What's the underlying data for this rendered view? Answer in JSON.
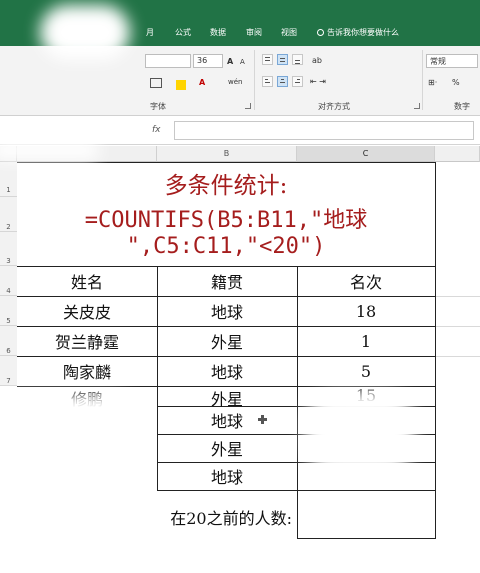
{
  "ribbon_tabs": [
    "月",
    "公式",
    "数据",
    "审阅",
    "视图"
  ],
  "tell_me": "告诉我你想要做什么",
  "font": {
    "size": "36",
    "grow": "A",
    "shrink": "A",
    "phonetic": "wén",
    "wen": "A"
  },
  "number_format": "常规",
  "number_percent": "%",
  "groups": {
    "font": "字体",
    "alignment": "对齐方式",
    "number": "数字"
  },
  "formula_bar": {
    "fx": "fx"
  },
  "columns": [
    "B",
    "C"
  ],
  "rows": [
    "1",
    "2",
    "3",
    "4",
    "5",
    "6",
    "7"
  ],
  "title": {
    "line1": "多条件统计:",
    "line2": "=COUNTIFS(B5:B11,\"地球",
    "line3": "\",C5:C11,\"<20\")"
  },
  "headers": {
    "name": "姓名",
    "origin": "籍贯",
    "rank": "名次"
  },
  "table": [
    {
      "name": "关皮皮",
      "origin": "地球",
      "rank": "18"
    },
    {
      "name": "贺兰静霆",
      "origin": "外星",
      "rank": "1"
    },
    {
      "name": "陶家麟",
      "origin": "地球",
      "rank": "5"
    },
    {
      "name": "修鹏",
      "origin": "外星",
      "rank": "15"
    },
    {
      "name": "",
      "origin": "地球",
      "rank": ""
    },
    {
      "name": "",
      "origin": "外星",
      "rank": ""
    },
    {
      "name": "",
      "origin": "地球",
      "rank": ""
    }
  ],
  "summary_label": "在20之前的人数:"
}
